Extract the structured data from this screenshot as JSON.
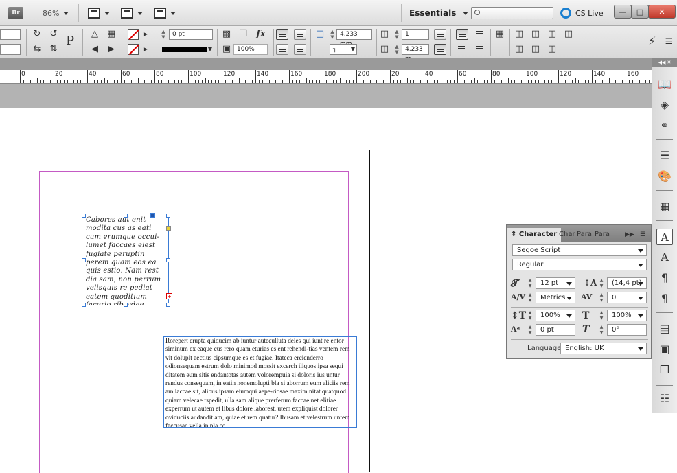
{
  "appbar": {
    "bridge": "Br",
    "zoom": "86%",
    "workspace": "Essentials",
    "search_placeholder": "",
    "cs_live": "CS Live"
  },
  "control": {
    "ref_point": "P",
    "stroke_weight": "0 pt",
    "opacity": "100%",
    "width_value": "4,233 mm",
    "height_value": "4,233 m",
    "columns": "1"
  },
  "ruler": {
    "labels": [
      "0",
      "20",
      "40",
      "60",
      "80",
      "100",
      "120",
      "140",
      "160",
      "180",
      "200",
      "20",
      "40",
      "60",
      "80",
      "100",
      "120",
      "140",
      "160"
    ]
  },
  "frame1": {
    "text": "Cabores aut enit modita cus as eati cum erumque occui-lumet faccaes elest fugiate peruptin perem quam eos ea quis estio. Nam rest dia sam, non perrum velisquis re pediat eatem quoditium facerio ribrydae."
  },
  "frame2": {
    "text": "Rorepert erupta quiducim ab iuntur auteculluta deles qui iunt re entor siminum ex eaque cus rero quam eturias es ent rehendi-tias ventem rem vit dolupit aectius cipsumque es et fugiae. Itateca ercienderro odionsequam estrum dolo minimod mossit excerch iliquos ipsa sequi ditatem eum sitis endantotas autem volorempuia si doloris ius untur rendus consequam, in eatin nonemolupti bla si aborrum eum aliciis rem am laccae sit, alibus ipsam eiumqui aepe-riosae maxim nitat quatquod quiam velecae rspedit, ulla sam alique prerferum faccae net elitiae experrum ut autem et libus dolore laborest, utem expliquist dolorer oviduciis audandit am, quiae et rem quatur? Ibusam et velestrum untem faccusae vella in pla co"
  },
  "character_panel": {
    "tabs": [
      "Character",
      "Char",
      "Para",
      "Para"
    ],
    "font_family": "Segoe Script",
    "font_style": "Regular",
    "font_size": "12 pt",
    "leading": "(14,4 pt)",
    "kerning": "Metrics",
    "tracking": "0",
    "vertical_scale": "100%",
    "horizontal_scale": "100%",
    "baseline_shift": "0 pt",
    "skew": "0°",
    "language_label": "Language:",
    "language": "English: UK"
  }
}
